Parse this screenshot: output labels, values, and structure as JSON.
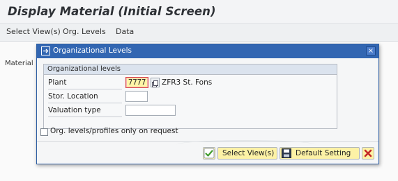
{
  "app": {
    "title": "Display Material (Initial Screen)"
  },
  "menu": {
    "items": [
      "Select View(s)",
      "Org. Levels",
      "Data"
    ]
  },
  "background": {
    "material_label": "Material"
  },
  "dialog": {
    "title": "Organizational Levels",
    "title_icon": "org-levels-icon",
    "close_icon": "close-icon",
    "close_label": "×",
    "group_title": "Organizational levels",
    "fields": {
      "plant_label": "Plant",
      "plant_value": "7777",
      "plant_description": "ZFR3 St. Fons",
      "stor_location_label": "Stor. Location",
      "stor_location_value": "",
      "valuation_type_label": "Valuation type",
      "valuation_type_value": ""
    },
    "checkbox_label": "Org. levels/profiles only on request",
    "checkbox_checked": false,
    "buttons": {
      "ok_icon": "checkmark-icon",
      "select_views_label": "Select View(s)",
      "select_views_icon": "views-icon",
      "default_setting_label": "Default Setting",
      "default_setting_icon": "save-icon",
      "cancel_icon": "cancel-x-icon"
    }
  },
  "colors": {
    "dialog_header": "#3266b2",
    "button_bg": "#fdf2a6",
    "required_border": "#d94848",
    "ok_green": "#3f9b2d",
    "cancel_red": "#c42626"
  }
}
